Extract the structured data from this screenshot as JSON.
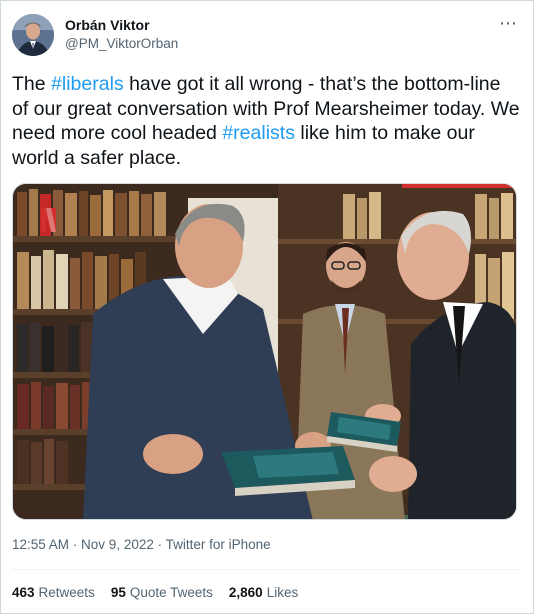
{
  "author": {
    "display_name": "Orbán Viktor",
    "handle": "@PM_ViktorOrban"
  },
  "more_icon": "more-horizontal-icon",
  "tweet": {
    "text_1": "The ",
    "hashtag_1": "#liberals",
    "text_2": " have got it all wrong - that’s the bottom-line of our great conversation with Prof Mearsheimer today. We need more cool headed ",
    "hashtag_2": "#realists",
    "text_3": " like him to make our world a safer place.",
    "hashtag_color": "#1d9bf0"
  },
  "meta": {
    "time": "12:55 AM",
    "separator_1": " · ",
    "date": "Nov 9, 2022",
    "separator_2": " · ",
    "source": "Twitter for iPhone"
  },
  "stats": {
    "retweets_count": "463",
    "retweets_label": "Retweets",
    "quotes_count": "95",
    "quotes_label": "Quote Tweets",
    "likes_count": "2,860",
    "likes_label": "Likes"
  }
}
